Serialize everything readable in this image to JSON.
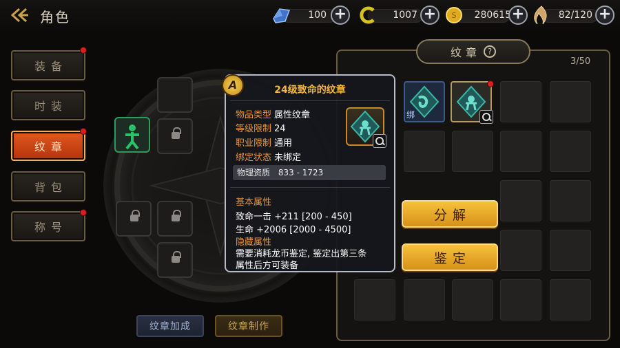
{
  "header": {
    "title": "角色"
  },
  "resources": [
    {
      "icon": "crystal-icon",
      "value": "100",
      "color": "#4a7fd1"
    },
    {
      "icon": "dragon-coin-icon",
      "value": "1007",
      "color": "#d7c21f"
    },
    {
      "icon": "gold-coin-icon",
      "value": "280615",
      "color": "#e3b424"
    },
    {
      "icon": "stamina-icon",
      "value": "82/120",
      "color": "#d3a55c"
    }
  ],
  "menu": [
    {
      "label": "装备",
      "badge": true
    },
    {
      "label": "时装",
      "badge": false
    },
    {
      "label": "纹章",
      "badge": true,
      "active": true
    },
    {
      "label": "背包",
      "badge": false
    },
    {
      "label": "称号",
      "badge": true
    }
  ],
  "bottom_buttons": {
    "combine": "纹章加成",
    "craft": "纹章制作"
  },
  "inventory": {
    "title": "纹章",
    "help": "?",
    "count": "3/50",
    "bound_tag": "绑"
  },
  "actions": {
    "decompose": "分解",
    "identify": "鉴定"
  },
  "tooltip": {
    "badge": "A",
    "title": "24级致命的纹章",
    "item_type_label": "物品类型",
    "item_type": "属性纹章",
    "level_label": "等级限制",
    "level": "24",
    "class_label": "职业限制",
    "class": "通用",
    "bind_label": "绑定状态",
    "bind": "未绑定",
    "phys_label": "物理资质",
    "phys": "833 - 1723",
    "base_title": "基本属性",
    "base_lines": [
      "致命一击 +211 [200 - 450]",
      "生命 +2006 [2000 - 4500]"
    ],
    "hidden_title": "隐藏属性",
    "hidden_lines": [
      "需要消耗龙币鉴定, 鉴定出第三条",
      "属性后方可装备"
    ]
  }
}
